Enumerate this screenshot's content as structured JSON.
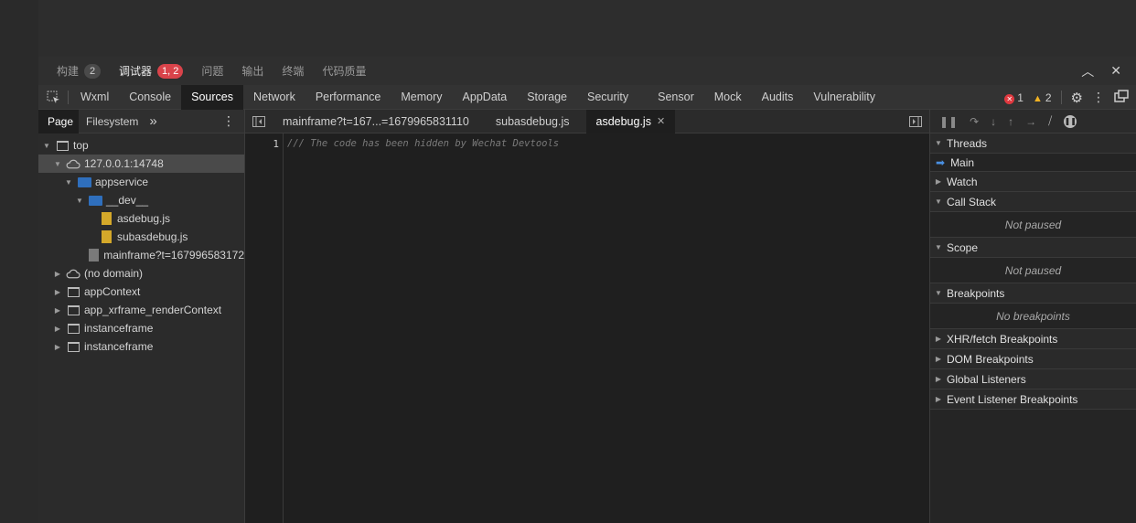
{
  "panel_tabs": [
    {
      "label": "构建",
      "badge": "2"
    },
    {
      "label": "调试器",
      "badge": "1, 2",
      "active": true
    },
    {
      "label": "问题"
    },
    {
      "label": "输出"
    },
    {
      "label": "终端"
    },
    {
      "label": "代码质量"
    }
  ],
  "window_controls": {
    "collapse_glyph": "︿",
    "close_glyph": "✕"
  },
  "devtools_tabs": [
    "Wxml",
    "Console",
    "Sources",
    "Network",
    "Performance",
    "Memory",
    "AppData",
    "Storage",
    "Security",
    "Sensor",
    "Mock",
    "Audits",
    "Vulnerability"
  ],
  "active_devtools_tab": "Sources",
  "status": {
    "errors": "1",
    "warnings": "2"
  },
  "navigator": {
    "tabs": [
      "Page",
      "Filesystem"
    ],
    "more": "»",
    "tree": [
      {
        "label": "top",
        "icon": "frame-icon"
      },
      {
        "label": "127.0.0.1:14748",
        "icon": "cloud-icon"
      },
      {
        "label": "appservice",
        "icon": "folder-icon"
      },
      {
        "label": "__dev__",
        "icon": "folder-icon"
      },
      {
        "label": "asdebug.js",
        "icon": "file-icon"
      },
      {
        "label": "subasdebug.js",
        "icon": "file-icon"
      },
      {
        "label": "mainframe?t=167996583172",
        "icon": "file-icon"
      },
      {
        "label": "(no domain)",
        "icon": "cloud-icon"
      },
      {
        "label": "appContext",
        "icon": "frame-icon"
      },
      {
        "label": "app_xrframe_renderContext",
        "icon": "frame-icon"
      },
      {
        "label": "instanceframe",
        "icon": "frame-icon"
      },
      {
        "label": "instanceframe",
        "icon": "frame-icon"
      }
    ]
  },
  "editor": {
    "tabs": [
      "mainframe?t=167...=1679965831110",
      "subasdebug.js",
      "asdebug.js"
    ],
    "active_tab": "asdebug.js",
    "line_number": "1",
    "code": "/// The code has been hidden by Wechat Devtools"
  },
  "debugger": {
    "threads": {
      "title": "Threads",
      "main": "Main"
    },
    "watch": "Watch",
    "call_stack": {
      "title": "Call Stack",
      "body": "Not paused"
    },
    "scope": {
      "title": "Scope",
      "body": "Not paused"
    },
    "breakpoints": {
      "title": "Breakpoints",
      "body": "No breakpoints"
    },
    "xhr": "XHR/fetch Breakpoints",
    "dom": "DOM Breakpoints",
    "global": "Global Listeners",
    "event": "Event Listener Breakpoints"
  }
}
